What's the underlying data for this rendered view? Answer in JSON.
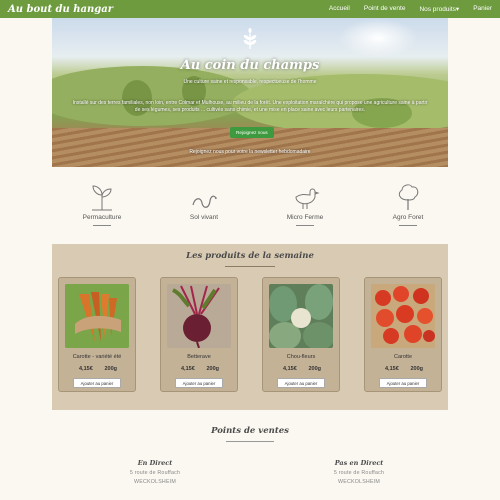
{
  "navbar": {
    "brand": "Au bout du hangar",
    "links": [
      "Accueil",
      "Point de vente",
      "Nos produits▾",
      "Panier"
    ]
  },
  "hero": {
    "title": "Au coin du champs",
    "subtitle": "Une culture saine et responsable, respectueuse de l'homme",
    "text": "Installé sur des terres familiales, non loin, entre Colmar et Mulhouse, au milieu de la forêt. Une exploitation maraîchère qui propose une agriculture saine à partir de ses légumes, ses produits ... cultivés sans chimie, et une mise en place saine avec leurs partenaires.",
    "button": "Rejoignez nous",
    "newsletter": "Rejoignez nous pour votre la newsletter hebdomadaire"
  },
  "features": [
    {
      "label": "Permaculture",
      "icon": "sprout-icon"
    },
    {
      "label": "Sol vivant",
      "icon": "worm-icon"
    },
    {
      "label": "Micro Ferme",
      "icon": "hen-icon"
    },
    {
      "label": "Agro Foret",
      "icon": "tree-icon"
    }
  ],
  "products": {
    "title": "Les produits de la semaine",
    "items": [
      {
        "name": "Carotte - variété été",
        "price": "4,15€",
        "weight": "200g",
        "button": "Ajouter au panier"
      },
      {
        "name": "Betterave",
        "price": "4,15€",
        "weight": "200g",
        "button": "Ajouter au panier"
      },
      {
        "name": "Chou-fleurs",
        "price": "4,15€",
        "weight": "200g",
        "button": "Ajouter au panier"
      },
      {
        "name": "Carotte",
        "price": "4,15€",
        "weight": "200g",
        "button": "Ajouter au panier"
      }
    ]
  },
  "points": {
    "title": "Points de ventes",
    "locations": [
      {
        "heading": "En Direct",
        "address": "5 route de Rouffach",
        "city": "WECKOLSHEIM"
      },
      {
        "heading": "Pas en Direct",
        "address": "5 route de Rouffach",
        "city": "WECKOLSHEIM"
      }
    ]
  },
  "colors": {
    "nav": "#6d9b3e",
    "button": "#3e9a3e",
    "products_bg": "#d9cab3",
    "card": "#c4b297"
  }
}
